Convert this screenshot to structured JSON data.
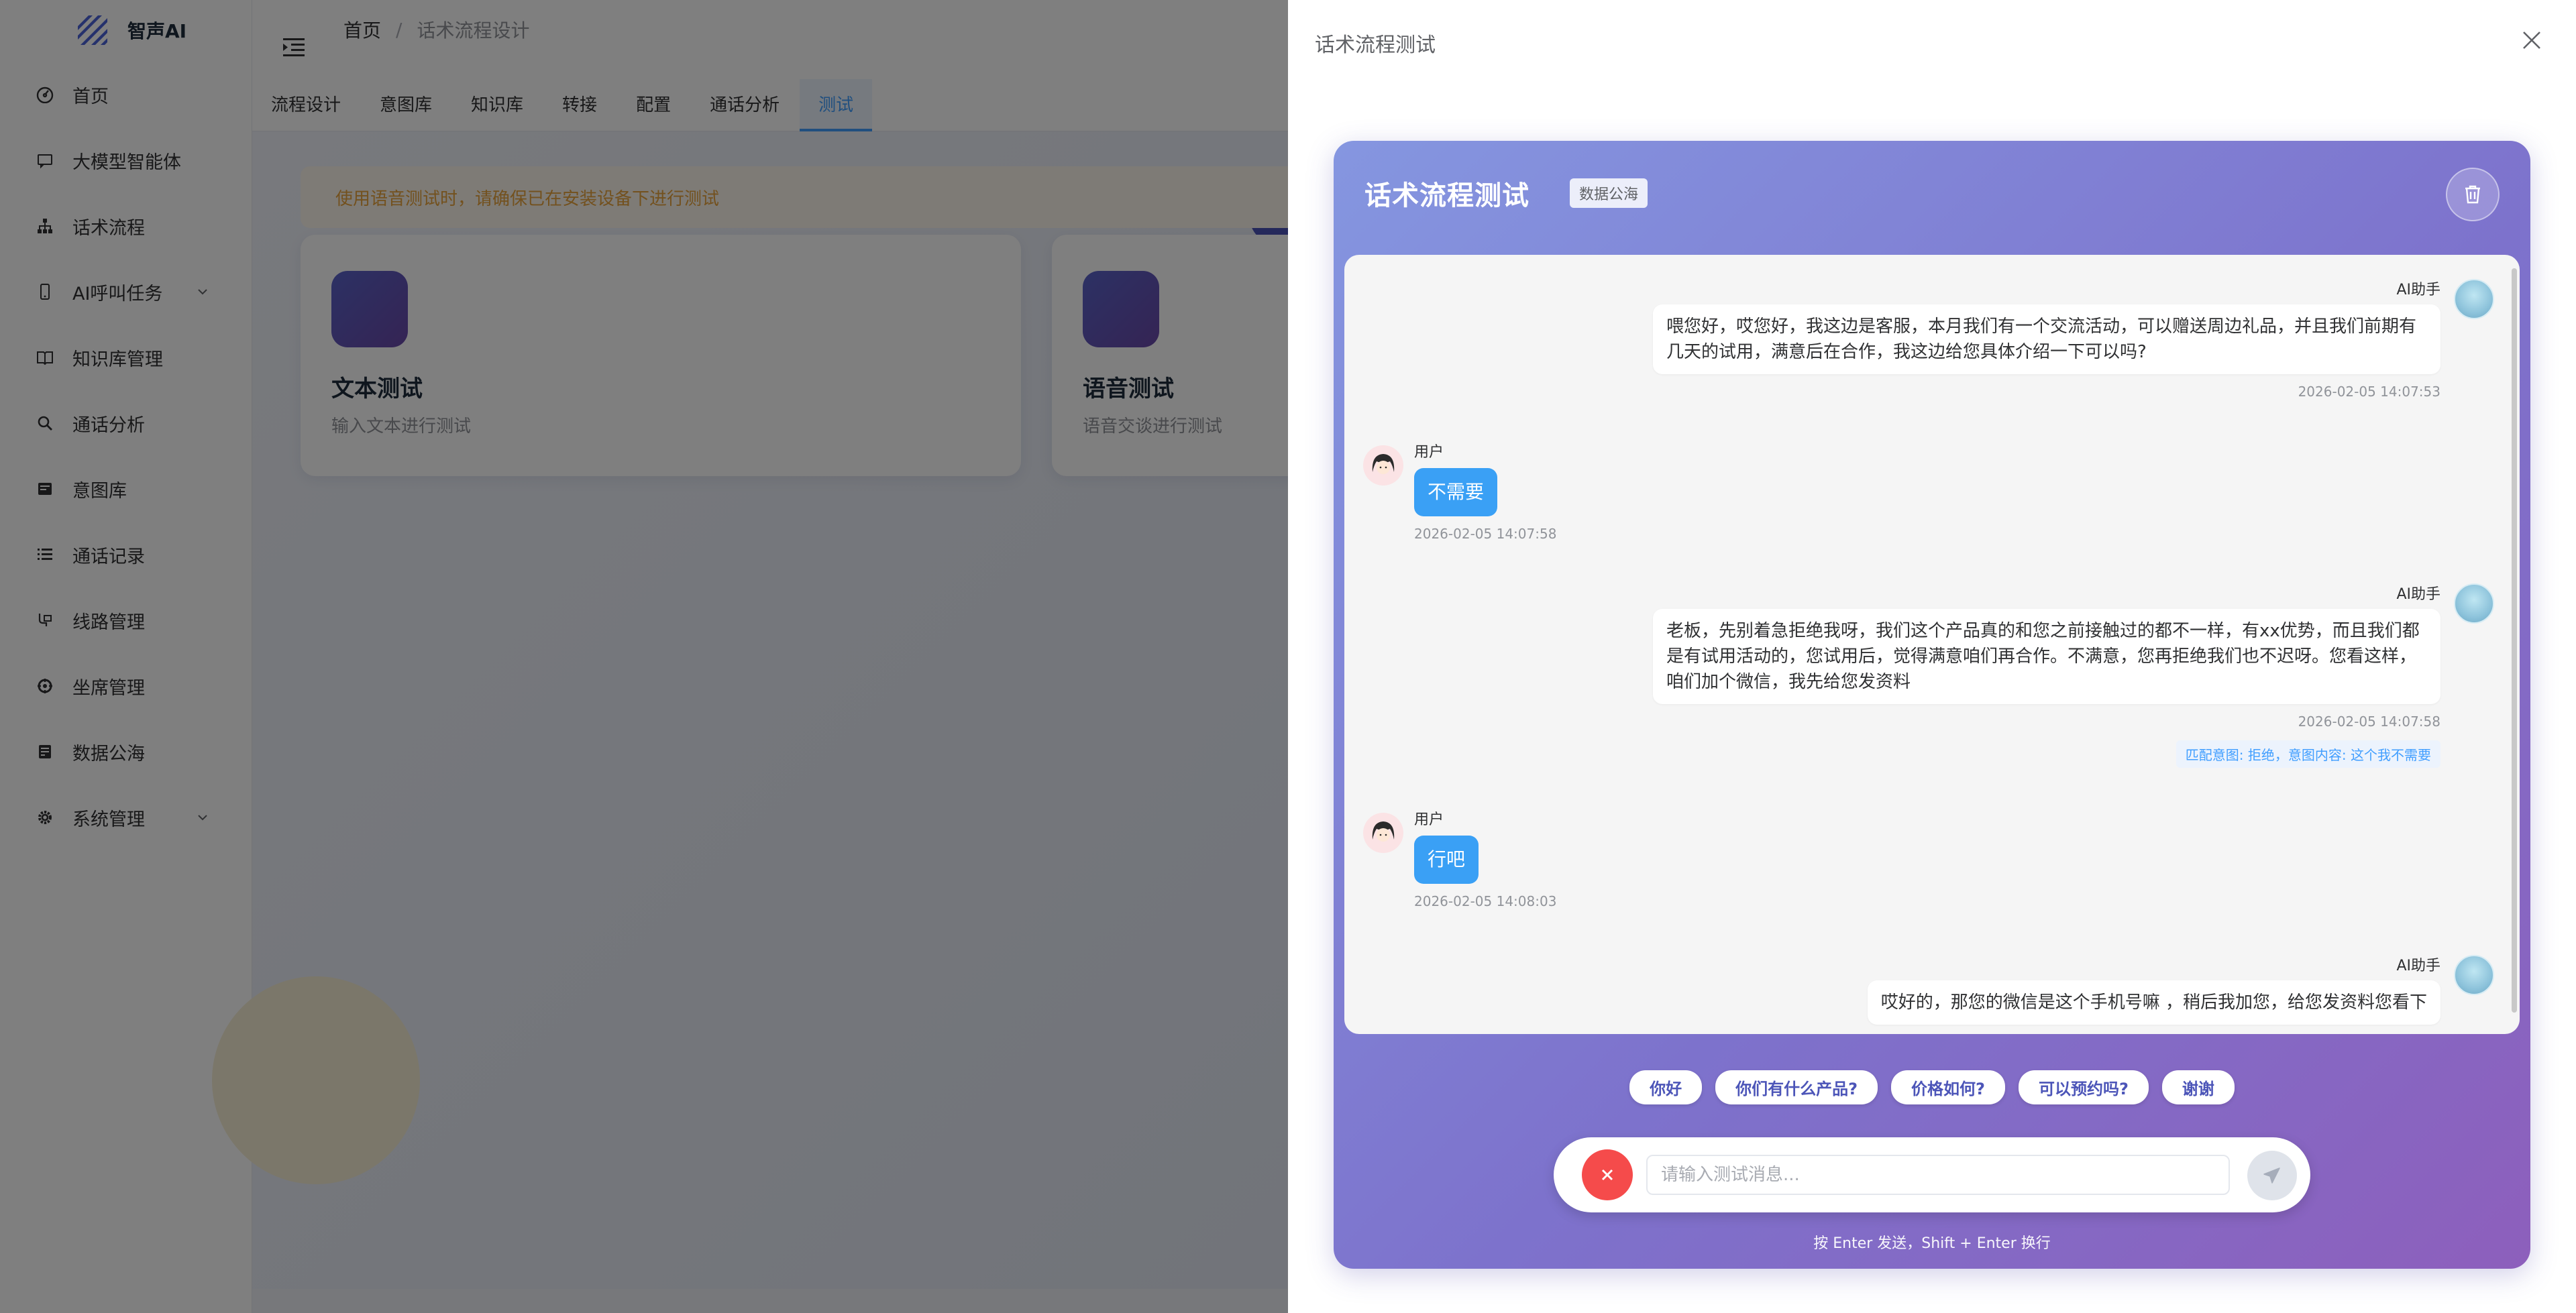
{
  "app": {
    "name": "智声AI"
  },
  "sidebar": {
    "items": [
      {
        "label": "首页",
        "icon": "dashboard-icon"
      },
      {
        "label": "大模型智能体",
        "icon": "message-icon"
      },
      {
        "label": "话术流程",
        "icon": "tree-icon"
      },
      {
        "label": "AI呼叫任务",
        "icon": "phone-icon"
      },
      {
        "label": "知识库管理",
        "icon": "book-icon"
      },
      {
        "label": "通话分析",
        "icon": "search-icon"
      },
      {
        "label": "意图库",
        "icon": "database-icon"
      },
      {
        "label": "通话记录",
        "icon": "list-icon"
      },
      {
        "label": "线路管理",
        "icon": "route-icon"
      },
      {
        "label": "坐席管理",
        "icon": "seat-icon"
      },
      {
        "label": "数据公海",
        "icon": "data-icon"
      },
      {
        "label": "系统管理",
        "icon": "gear-icon"
      }
    ]
  },
  "header": {
    "breadcrumb": {
      "home": "首页",
      "separator": "/",
      "current": "话术流程设计"
    }
  },
  "tabs": [
    {
      "label": "流程设计"
    },
    {
      "label": "意图库"
    },
    {
      "label": "知识库"
    },
    {
      "label": "转接"
    },
    {
      "label": "配置"
    },
    {
      "label": "通话分析"
    },
    {
      "label": "测试"
    }
  ],
  "content": {
    "alert": "使用语音测试时，请确保已在安装设备下进行测试",
    "cards": [
      {
        "title": "文本测试",
        "desc": "输入文本进行测试"
      },
      {
        "title": "语音测试",
        "desc": "语音交谈进行测试"
      }
    ]
  },
  "drawer": {
    "title": "话术流程测试",
    "panel_title": "话术流程测试",
    "badge": "数据公海",
    "messages": [
      {
        "role": "ai",
        "sender": "AI助手",
        "text": "喂您好，哎您好，我这边是客服，本月我们有一个交流活动，可以赠送周边礼品，并且我们前期有几天的试用，满意后在合作，我这边给您具体介绍一下可以吗?",
        "time": "2026-02-05 14:07:53"
      },
      {
        "role": "user",
        "sender": "用户",
        "text": "不需要",
        "time": "2026-02-05 14:07:58"
      },
      {
        "role": "ai",
        "sender": "AI助手",
        "text": "老板，先别着急拒绝我呀，我们这个产品真的和您之前接触过的都不一样，有xx优势，而且我们都是有试用活动的，您试用后，觉得满意咱们再合作。不满意，您再拒绝我们也不迟呀。您看这样，咱们加个微信，我先给您发资料",
        "time": "2026-02-05 14:07:58",
        "intent": "匹配意图: 拒绝，意图内容: 这个我不需要"
      },
      {
        "role": "user",
        "sender": "用户",
        "text": "行吧",
        "time": "2026-02-05 14:08:03"
      },
      {
        "role": "ai",
        "sender": "AI助手",
        "text": "哎好的，那您的微信是这个手机号嘛 ，稍后我加您，给您发资料您看下"
      }
    ],
    "quick_replies": [
      "你好",
      "你们有什么产品?",
      "价格如何?",
      "可以预约吗?",
      "谢谢"
    ],
    "input": {
      "placeholder": "请输入测试消息...",
      "value": ""
    },
    "hint": "按 Enter 发送，Shift + Enter 换行"
  }
}
